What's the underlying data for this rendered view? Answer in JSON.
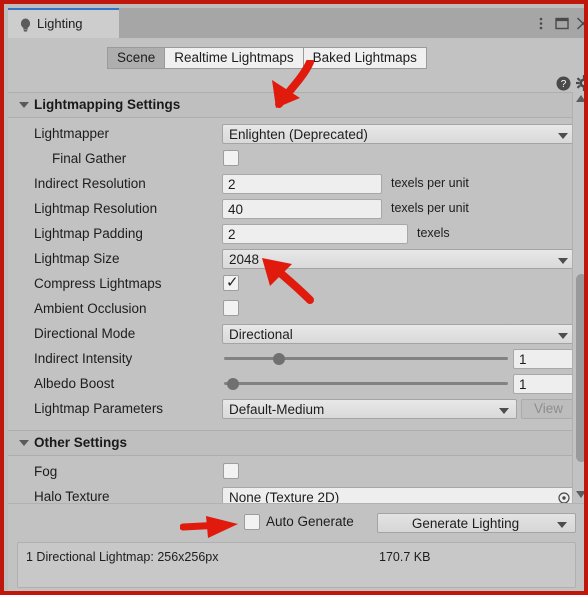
{
  "window": {
    "tab_title": "Lighting",
    "tab_icon": "lightbulb-icon",
    "controls": {
      "kebab": "kebab-menu-icon",
      "maximize": "maximize-icon",
      "close": "close-icon"
    },
    "accent_red": "#c0170c",
    "tab_underline": "#3575c6",
    "background": "#c2c2c2"
  },
  "toolbar": {
    "tabs": [
      {
        "label": "Scene",
        "active": true
      },
      {
        "label": "Realtime Lightmaps",
        "active": false
      },
      {
        "label": "Baked Lightmaps",
        "active": false
      }
    ],
    "help_icon": "help-circle-icon",
    "settings_icon": "gear-icon"
  },
  "sections": {
    "lightmapping": {
      "title": "Lightmapping Settings",
      "rows": {
        "lightmapper": {
          "label": "Lightmapper",
          "value": "Enlighten (Deprecated)"
        },
        "final_gather": {
          "label": "Final Gather",
          "checked": false
        },
        "indirect_resolution": {
          "label": "Indirect Resolution",
          "value": "2",
          "suffix": "texels per unit"
        },
        "lightmap_resolution": {
          "label": "Lightmap Resolution",
          "value": "40",
          "suffix": "texels per unit"
        },
        "lightmap_padding": {
          "label": "Lightmap Padding",
          "value": "2",
          "suffix": "texels"
        },
        "lightmap_size": {
          "label": "Lightmap Size",
          "value": "2048"
        },
        "compress_lightmaps": {
          "label": "Compress Lightmaps",
          "checked": true,
          "tick": "✓"
        },
        "ambient_occlusion": {
          "label": "Ambient Occlusion",
          "checked": false
        },
        "directional_mode": {
          "label": "Directional Mode",
          "value": "Directional"
        },
        "indirect_intensity": {
          "label": "Indirect Intensity",
          "value": "1",
          "knob_percent": 18
        },
        "albedo_boost": {
          "label": "Albedo Boost",
          "value": "1",
          "knob_percent": 1
        },
        "lightmap_parameters": {
          "label": "Lightmap Parameters",
          "value": "Default-Medium",
          "button": "View"
        }
      }
    },
    "other": {
      "title": "Other Settings",
      "rows": {
        "fog": {
          "label": "Fog",
          "checked": false
        },
        "halo_texture": {
          "label": "Halo Texture",
          "value": "None (Texture 2D)",
          "picker_icon": "object-picker-icon"
        }
      }
    }
  },
  "bottom": {
    "auto_generate_label": "Auto Generate",
    "auto_generate_checked": false,
    "generate_button": "Generate Lighting",
    "status_left": "1 Directional Lightmap: 256x256px",
    "status_right": "170.7 KB"
  },
  "scrollbar": {
    "up_arrow": "scroll-up-arrow",
    "down_arrow": "scroll-down-arrow"
  },
  "annotations": {
    "arrow_color": "#e01b0e",
    "items": [
      {
        "name": "arrow-to-lightmapper",
        "direction": "down-left"
      },
      {
        "name": "arrow-to-lightmap-size",
        "direction": "up-left"
      },
      {
        "name": "arrow-to-auto-generate",
        "direction": "right"
      }
    ]
  }
}
